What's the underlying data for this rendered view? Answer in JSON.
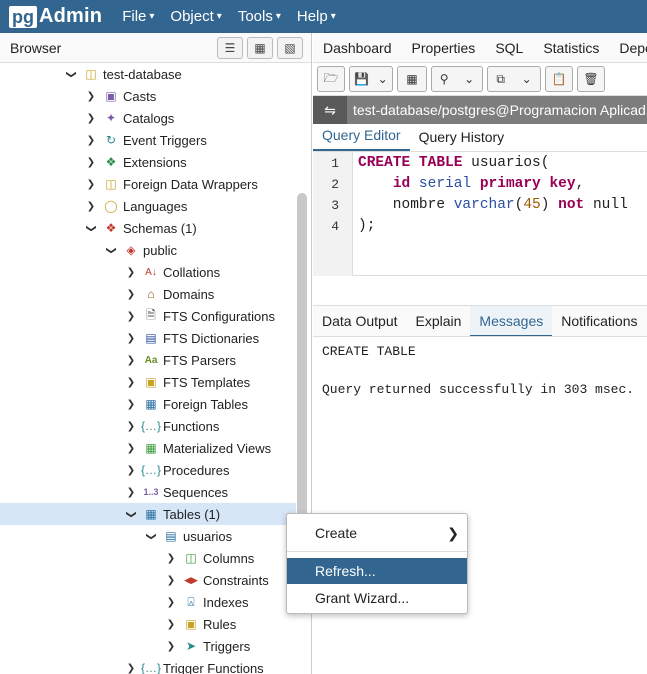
{
  "app": {
    "logo_pg": "pg",
    "logo_admin": "Admin"
  },
  "menu": [
    {
      "label": "File"
    },
    {
      "label": "Object"
    },
    {
      "label": "Tools"
    },
    {
      "label": "Help"
    }
  ],
  "browser": {
    "title": "Browser",
    "tree": [
      {
        "label": "test-database",
        "icon": "database-icon",
        "chev": "v"
      },
      {
        "label": "Casts",
        "icon": "casts-icon",
        "chev": ">"
      },
      {
        "label": "Catalogs",
        "icon": "catalogs-icon",
        "chev": ">"
      },
      {
        "label": "Event Triggers",
        "icon": "event-triggers-icon",
        "chev": ">"
      },
      {
        "label": "Extensions",
        "icon": "extensions-icon",
        "chev": ">"
      },
      {
        "label": "Foreign Data Wrappers",
        "icon": "fdw-icon",
        "chev": ">"
      },
      {
        "label": "Languages",
        "icon": "languages-icon",
        "chev": ">"
      },
      {
        "label": "Schemas (1)",
        "icon": "schemas-icon",
        "chev": "v"
      },
      {
        "label": "public",
        "icon": "schema-icon",
        "chev": "v"
      },
      {
        "label": "Collations",
        "icon": "collations-icon",
        "chev": ">"
      },
      {
        "label": "Domains",
        "icon": "domains-icon",
        "chev": ">"
      },
      {
        "label": "FTS Configurations",
        "icon": "fts-config-icon",
        "chev": ">"
      },
      {
        "label": "FTS Dictionaries",
        "icon": "fts-dict-icon",
        "chev": ">"
      },
      {
        "label": "FTS Parsers",
        "icon": "fts-parsers-icon",
        "chev": ">"
      },
      {
        "label": "FTS Templates",
        "icon": "fts-templates-icon",
        "chev": ">"
      },
      {
        "label": "Foreign Tables",
        "icon": "foreign-tables-icon",
        "chev": ">"
      },
      {
        "label": "Functions",
        "icon": "functions-icon",
        "chev": ">"
      },
      {
        "label": "Materialized Views",
        "icon": "mat-views-icon",
        "chev": ">"
      },
      {
        "label": "Procedures",
        "icon": "procedures-icon",
        "chev": ">"
      },
      {
        "label": "Sequences",
        "icon": "sequences-icon",
        "chev": ">"
      },
      {
        "label": "Tables (1)",
        "icon": "tables-icon",
        "chev": "v"
      },
      {
        "label": "usuarios",
        "icon": "table-icon",
        "chev": "v"
      },
      {
        "label": "Columns",
        "icon": "columns-icon",
        "chev": ">"
      },
      {
        "label": "Constraints",
        "icon": "constraints-icon",
        "chev": ">"
      },
      {
        "label": "Indexes",
        "icon": "indexes-icon",
        "chev": ">"
      },
      {
        "label": "Rules",
        "icon": "rules-icon",
        "chev": ">"
      },
      {
        "label": "Triggers",
        "icon": "triggers-icon",
        "chev": ">"
      },
      {
        "label": "Trigger Functions",
        "icon": "trigger-functions-icon",
        "chev": ">"
      }
    ]
  },
  "main_tabs": [
    {
      "label": "Dashboard"
    },
    {
      "label": "Properties"
    },
    {
      "label": "SQL"
    },
    {
      "label": "Statistics"
    },
    {
      "label": "Depe"
    }
  ],
  "connection": {
    "label": "test-database/postgres@Programacion Aplicad"
  },
  "query_tabs": [
    {
      "label": "Query Editor"
    },
    {
      "label": "Query History"
    }
  ],
  "editor": {
    "line_numbers": [
      "1",
      "2",
      "3",
      "4"
    ]
  },
  "output_tabs": [
    {
      "label": "Data Output"
    },
    {
      "label": "Explain"
    },
    {
      "label": "Messages"
    },
    {
      "label": "Notifications"
    }
  ],
  "messages": {
    "line1": "CREATE TABLE",
    "line2": "Query returned successfully in 303 msec."
  },
  "context_menu": {
    "items": [
      {
        "label": "Create"
      },
      {
        "label": "Refresh..."
      },
      {
        "label": "Grant Wizard..."
      }
    ]
  },
  "colors": {
    "accent": "#326690",
    "selected_row": "#d6e6f7"
  }
}
